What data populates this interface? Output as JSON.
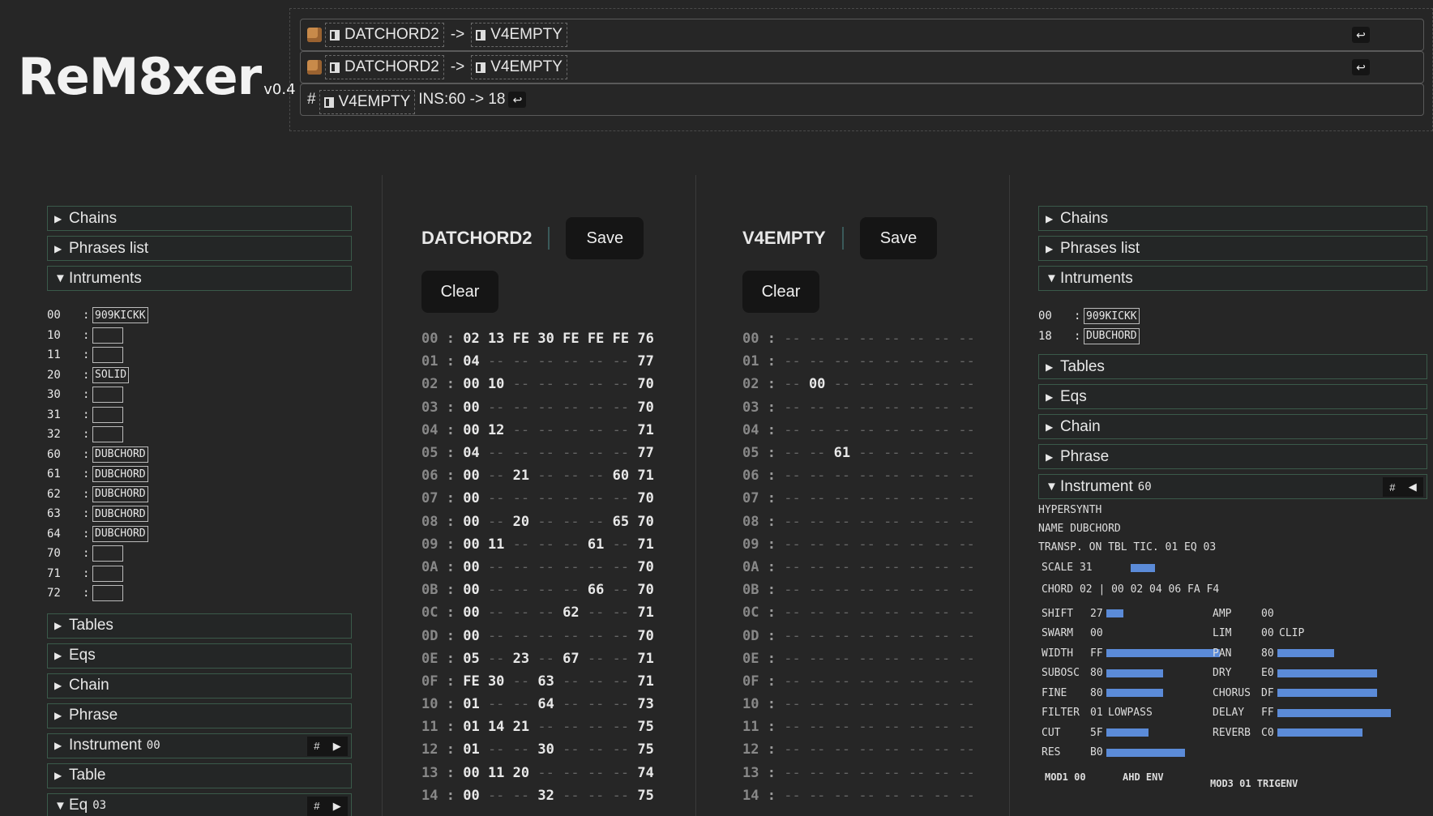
{
  "logo": {
    "name": "ReM8xer",
    "version": "v0.4"
  },
  "operations": [
    {
      "from": "DATCHORD2",
      "arrow": "->",
      "to": "V4EMPTY",
      "ret": "↩"
    },
    {
      "from": "DATCHORD2",
      "arrow": "->",
      "to": "V4EMPTY",
      "ret": "↩"
    },
    {
      "hash": "#",
      "target": "V4EMPTY",
      "text": "INS:60 -> 18",
      "ret": "↩"
    }
  ],
  "left_panel": {
    "sections_top": [
      "Chains",
      "Phrases list",
      "Intruments"
    ],
    "instruments": [
      {
        "k": "00",
        "name": "909KICKK"
      },
      {
        "k": "10",
        "name": ""
      },
      {
        "k": "11",
        "name": ""
      },
      {
        "k": "20",
        "name": "SOLID"
      },
      {
        "k": "30",
        "name": ""
      },
      {
        "k": "31",
        "name": ""
      },
      {
        "k": "32",
        "name": ""
      },
      {
        "k": "60",
        "name": "DUBCHORD"
      },
      {
        "k": "61",
        "name": "DUBCHORD"
      },
      {
        "k": "62",
        "name": "DUBCHORD"
      },
      {
        "k": "63",
        "name": "DUBCHORD"
      },
      {
        "k": "64",
        "name": "DUBCHORD"
      },
      {
        "k": "70",
        "name": ""
      },
      {
        "k": "71",
        "name": ""
      },
      {
        "k": "72",
        "name": ""
      }
    ],
    "sections_bottom": [
      "Tables",
      "Eqs",
      "Chain",
      "Phrase"
    ],
    "instrument_label": "Instrument",
    "instrument_num": "00",
    "table_label": "Table",
    "eq_label": "Eq",
    "eq_num": "03",
    "hash": "#",
    "play": "▶"
  },
  "song_left": {
    "title": "DATCHORD2",
    "save": "Save",
    "clear": "Clear",
    "rows": [
      {
        "i": "00",
        "c": [
          "02",
          "13",
          "FE",
          "30",
          "FE",
          "FE",
          "FE",
          "76"
        ]
      },
      {
        "i": "01",
        "c": [
          "04",
          "--",
          "--",
          "--",
          "--",
          "--",
          "--",
          "77"
        ]
      },
      {
        "i": "02",
        "c": [
          "00",
          "10",
          "--",
          "--",
          "--",
          "--",
          "--",
          "70"
        ]
      },
      {
        "i": "03",
        "c": [
          "00",
          "--",
          "--",
          "--",
          "--",
          "--",
          "--",
          "70"
        ]
      },
      {
        "i": "04",
        "c": [
          "00",
          "12",
          "--",
          "--",
          "--",
          "--",
          "--",
          "71"
        ]
      },
      {
        "i": "05",
        "c": [
          "04",
          "--",
          "--",
          "--",
          "--",
          "--",
          "--",
          "77"
        ]
      },
      {
        "i": "06",
        "c": [
          "00",
          "--",
          "21",
          "--",
          "--",
          "--",
          "60",
          "71"
        ]
      },
      {
        "i": "07",
        "c": [
          "00",
          "--",
          "--",
          "--",
          "--",
          "--",
          "--",
          "70"
        ]
      },
      {
        "i": "08",
        "c": [
          "00",
          "--",
          "20",
          "--",
          "--",
          "--",
          "65",
          "70"
        ]
      },
      {
        "i": "09",
        "c": [
          "00",
          "11",
          "--",
          "--",
          "--",
          "61",
          "--",
          "71"
        ]
      },
      {
        "i": "0A",
        "c": [
          "00",
          "--",
          "--",
          "--",
          "--",
          "--",
          "--",
          "70"
        ]
      },
      {
        "i": "0B",
        "c": [
          "00",
          "--",
          "--",
          "--",
          "--",
          "66",
          "--",
          "70"
        ]
      },
      {
        "i": "0C",
        "c": [
          "00",
          "--",
          "--",
          "--",
          "62",
          "--",
          "--",
          "71"
        ]
      },
      {
        "i": "0D",
        "c": [
          "00",
          "--",
          "--",
          "--",
          "--",
          "--",
          "--",
          "70"
        ]
      },
      {
        "i": "0E",
        "c": [
          "05",
          "--",
          "23",
          "--",
          "67",
          "--",
          "--",
          "71"
        ]
      },
      {
        "i": "0F",
        "c": [
          "FE",
          "30",
          "--",
          "63",
          "--",
          "--",
          "--",
          "71"
        ]
      },
      {
        "i": "10",
        "c": [
          "01",
          "--",
          "--",
          "64",
          "--",
          "--",
          "--",
          "73"
        ]
      },
      {
        "i": "11",
        "c": [
          "01",
          "14",
          "21",
          "--",
          "--",
          "--",
          "--",
          "75"
        ]
      },
      {
        "i": "12",
        "c": [
          "01",
          "--",
          "--",
          "30",
          "--",
          "--",
          "--",
          "75"
        ]
      },
      {
        "i": "13",
        "c": [
          "00",
          "11",
          "20",
          "--",
          "--",
          "--",
          "--",
          "74"
        ]
      },
      {
        "i": "14",
        "c": [
          "00",
          "--",
          "--",
          "32",
          "--",
          "--",
          "--",
          "75"
        ]
      }
    ]
  },
  "song_right": {
    "title": "V4EMPTY",
    "save": "Save",
    "clear": "Clear",
    "rows": [
      {
        "i": "00",
        "c": [
          "--",
          "--",
          "--",
          "--",
          "--",
          "--",
          "--",
          "--"
        ]
      },
      {
        "i": "01",
        "c": [
          "--",
          "--",
          "--",
          "--",
          "--",
          "--",
          "--",
          "--"
        ]
      },
      {
        "i": "02",
        "c": [
          "--",
          "00",
          "--",
          "--",
          "--",
          "--",
          "--",
          "--"
        ]
      },
      {
        "i": "03",
        "c": [
          "--",
          "--",
          "--",
          "--",
          "--",
          "--",
          "--",
          "--"
        ]
      },
      {
        "i": "04",
        "c": [
          "--",
          "--",
          "--",
          "--",
          "--",
          "--",
          "--",
          "--"
        ]
      },
      {
        "i": "05",
        "c": [
          "--",
          "--",
          "61",
          "--",
          "--",
          "--",
          "--",
          "--"
        ]
      },
      {
        "i": "06",
        "c": [
          "--",
          "--",
          "--",
          "--",
          "--",
          "--",
          "--",
          "--"
        ]
      },
      {
        "i": "07",
        "c": [
          "--",
          "--",
          "--",
          "--",
          "--",
          "--",
          "--",
          "--"
        ]
      },
      {
        "i": "08",
        "c": [
          "--",
          "--",
          "--",
          "--",
          "--",
          "--",
          "--",
          "--"
        ]
      },
      {
        "i": "09",
        "c": [
          "--",
          "--",
          "--",
          "--",
          "--",
          "--",
          "--",
          "--"
        ]
      },
      {
        "i": "0A",
        "c": [
          "--",
          "--",
          "--",
          "--",
          "--",
          "--",
          "--",
          "--"
        ]
      },
      {
        "i": "0B",
        "c": [
          "--",
          "--",
          "--",
          "--",
          "--",
          "--",
          "--",
          "--"
        ]
      },
      {
        "i": "0C",
        "c": [
          "--",
          "--",
          "--",
          "--",
          "--",
          "--",
          "--",
          "--"
        ]
      },
      {
        "i": "0D",
        "c": [
          "--",
          "--",
          "--",
          "--",
          "--",
          "--",
          "--",
          "--"
        ]
      },
      {
        "i": "0E",
        "c": [
          "--",
          "--",
          "--",
          "--",
          "--",
          "--",
          "--",
          "--"
        ]
      },
      {
        "i": "0F",
        "c": [
          "--",
          "--",
          "--",
          "--",
          "--",
          "--",
          "--",
          "--"
        ]
      },
      {
        "i": "10",
        "c": [
          "--",
          "--",
          "--",
          "--",
          "--",
          "--",
          "--",
          "--"
        ]
      },
      {
        "i": "11",
        "c": [
          "--",
          "--",
          "--",
          "--",
          "--",
          "--",
          "--",
          "--"
        ]
      },
      {
        "i": "12",
        "c": [
          "--",
          "--",
          "--",
          "--",
          "--",
          "--",
          "--",
          "--"
        ]
      },
      {
        "i": "13",
        "c": [
          "--",
          "--",
          "--",
          "--",
          "--",
          "--",
          "--",
          "--"
        ]
      },
      {
        "i": "14",
        "c": [
          "--",
          "--",
          "--",
          "--",
          "--",
          "--",
          "--",
          "--"
        ]
      }
    ]
  },
  "right_panel": {
    "sections_top": [
      "Chains",
      "Phrases list",
      "Intruments"
    ],
    "instruments": [
      {
        "k": "00",
        "name": "909KICKK"
      },
      {
        "k": "18",
        "name": "DUBCHORD"
      }
    ],
    "sections_mid": [
      "Tables",
      "Eqs",
      "Chain",
      "Phrase"
    ],
    "instrument_label": "Instrument",
    "instrument_num": "60",
    "hash": "#",
    "back": "◀",
    "detail": {
      "type": "HYPERSYNTH",
      "name_line": "NAME DUBCHORD",
      "transp_line": "TRANSP. ON  TBL TIC. 01  EQ 03",
      "scale_label": "SCALE 31",
      "chord_line": "CHORD 02 | 00 02 04 06 FA F4",
      "params_left": [
        {
          "label": "SHIFT",
          "value": "27",
          "level": 0.15
        },
        {
          "label": "SWARM",
          "value": "00",
          "level": 0
        },
        {
          "label": "WIDTH",
          "value": "FF",
          "level": 1.0
        },
        {
          "label": "SUBOSC",
          "value": "80",
          "level": 0.5
        },
        {
          "label": "FINE",
          "value": "80",
          "level": 0.5
        },
        {
          "label": "FILTER",
          "value": "01",
          "extra": "LOWPASS",
          "level": 0
        },
        {
          "label": "CUT",
          "value": "5F",
          "level": 0.37
        },
        {
          "label": "RES",
          "value": "B0",
          "level": 0.69
        }
      ],
      "params_right": [
        {
          "label": "AMP",
          "value": "00",
          "level": 0
        },
        {
          "label": "LIM",
          "value": "00",
          "extra": "CLIP",
          "level": 0
        },
        {
          "label": "PAN",
          "value": "80",
          "level": 0.5
        },
        {
          "label": "DRY",
          "value": "E0",
          "level": 0.88
        },
        {
          "label": "CHORUS",
          "value": "DF",
          "level": 0.88
        },
        {
          "label": "DELAY",
          "value": "FF",
          "level": 1.0
        },
        {
          "label": "REVERB",
          "value": "C0",
          "level": 0.75
        }
      ],
      "mod1": "MOD1 00",
      "ahd": "AHD ENV",
      "mod3": "MOD3 01 TRIGENV"
    }
  },
  "colors": {
    "bar": "#5b8bd8",
    "border": "#3a5a4a",
    "background": "#262626"
  }
}
